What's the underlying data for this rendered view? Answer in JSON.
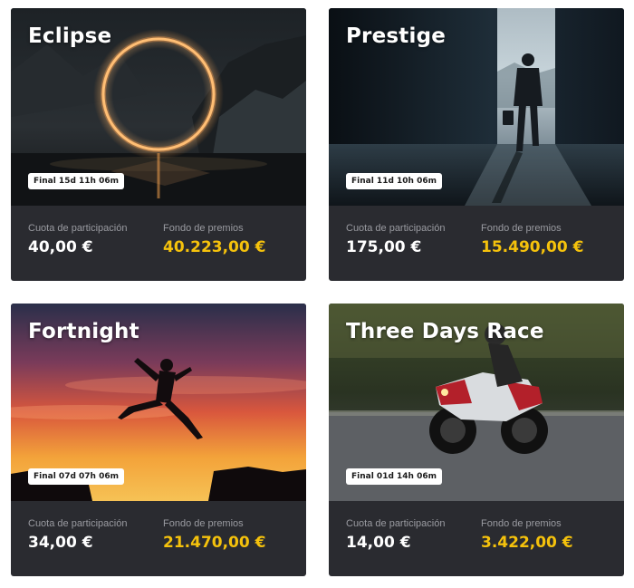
{
  "tournaments": [
    {
      "title": "Eclipse",
      "timer": "Final 15d 11h 06m",
      "fee_label": "Cuota de participación",
      "fee": "40,00 €",
      "prize_label": "Fondo de premios",
      "prize": "40.223,00 €"
    },
    {
      "title": "Prestige",
      "timer": "Final 11d 10h 06m",
      "fee_label": "Cuota de participación",
      "fee": "175,00 €",
      "prize_label": "Fondo de premios",
      "prize": "15.490,00 €"
    },
    {
      "title": "Fortnight",
      "timer": "Final 07d 07h 06m",
      "fee_label": "Cuota de participación",
      "fee": "34,00 €",
      "prize_label": "Fondo de premios",
      "prize": "21.470,00 €"
    },
    {
      "title": "Three Days Race",
      "timer": "Final 01d 14h 06m",
      "fee_label": "Cuota de participación",
      "fee": "14,00 €",
      "prize_label": "Fondo de premios",
      "prize": "3.422,00 €"
    }
  ],
  "colors": {
    "card_bg": "#2a2b30",
    "prize": "#f5c20c",
    "label": "#9a9ba1"
  }
}
